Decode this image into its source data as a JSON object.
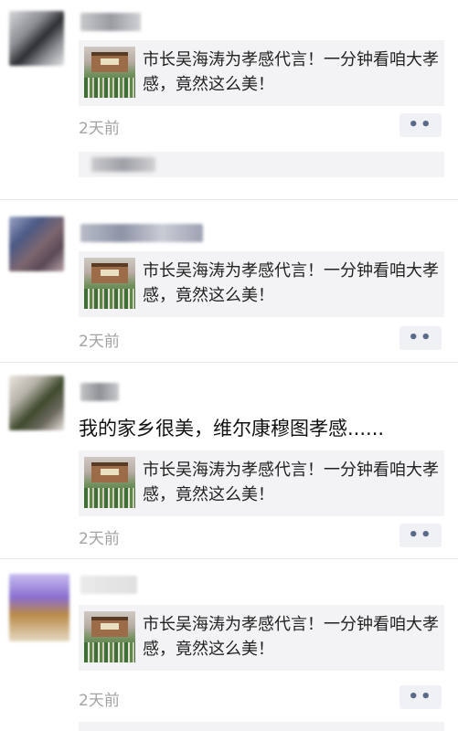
{
  "posts": [
    {
      "text": "",
      "link_title": "市长吴海涛为孝感代言！一分钟看咱大孝感，竟然这么美！",
      "time": "2天前",
      "avatar_colors": [
        "#2e2f33",
        "#8b8d92",
        "#d5d6d8"
      ],
      "name_colors": [
        "#c7c9cc",
        "#9a9ca1"
      ]
    },
    {
      "text": "",
      "link_title": "市长吴海涛为孝感代言！一分钟看咱大孝感，竟然这么美！",
      "time": "2天前",
      "avatar_colors": [
        "#4c5a86",
        "#7d6770",
        "#b7a0a8"
      ],
      "name_colors": [
        "#c3c6cf",
        "#8e93a6"
      ]
    },
    {
      "text": "我的家乡很美，维尔康穆图孝感......",
      "link_title": "市长吴海涛为孝感代言！一分钟看咱大孝感，竟然这么美！",
      "time": "2天前",
      "avatar_colors": [
        "#3e4a2c",
        "#b8b3aa",
        "#e8e3dc"
      ],
      "name_colors": [
        "#c4c5c8",
        "#8f9196"
      ]
    },
    {
      "text": "",
      "link_title": "市长吴海涛为孝感代言！一分钟看咱大孝感，竟然这么美！",
      "time": "2天前",
      "avatar_colors": [
        "#8a6fd0",
        "#b88a48",
        "#e6d9c2"
      ],
      "name_colors": [
        "#eaeaea",
        "#e0e0e0"
      ]
    }
  ],
  "more_icon": "more-dots-icon",
  "colors": {
    "time_text": "#a3a3a3",
    "card_bg": "#f3f3f5",
    "more_dots": "#5b6a8b"
  }
}
